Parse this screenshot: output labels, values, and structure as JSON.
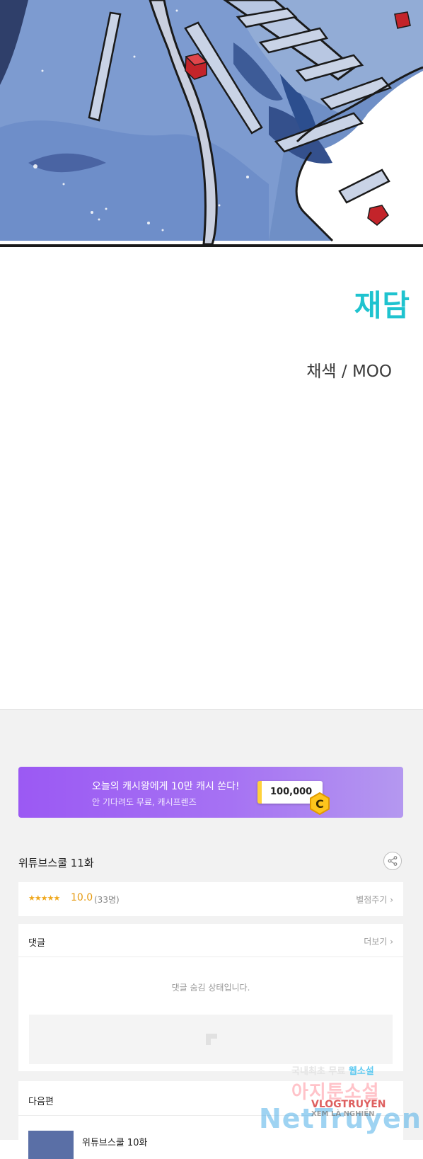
{
  "credits": {
    "studio_logo": "재담",
    "colorist": "채색 / MOO"
  },
  "banner": {
    "title": "오늘의 캐시왕에게 10만 캐시 쏜다!",
    "subtitle": "안 기다려도 무료, 캐시프렌즈",
    "amount": "100,000",
    "coin_letter": "C",
    "colors": {
      "gradient_start": "#9b59f3",
      "gradient_end": "#b498f0",
      "coin": "#ffc51c"
    }
  },
  "episode": {
    "title": "위튜브스쿨 11화"
  },
  "rating": {
    "stars": "★★★★★",
    "score": "10.0",
    "count": "(33명)",
    "rate_link": "별점주기 ›",
    "star_color": "#f0a81d"
  },
  "comments": {
    "header": "댓글",
    "more_link": "더보기 ›",
    "status": "댓글 숨김 상태입니다."
  },
  "next": {
    "header": "다음편",
    "episode_title": "위튜브스쿨 10화"
  },
  "watermark": {
    "line1_prefix": "국내최초 무료 ",
    "line1_highlight": "웹소설",
    "line2": "아지툰소설",
    "vlog": "VLOGTRUYEN",
    "net": "NetTruyen",
    "sub": "XEM LÀ NGHIỀN"
  }
}
